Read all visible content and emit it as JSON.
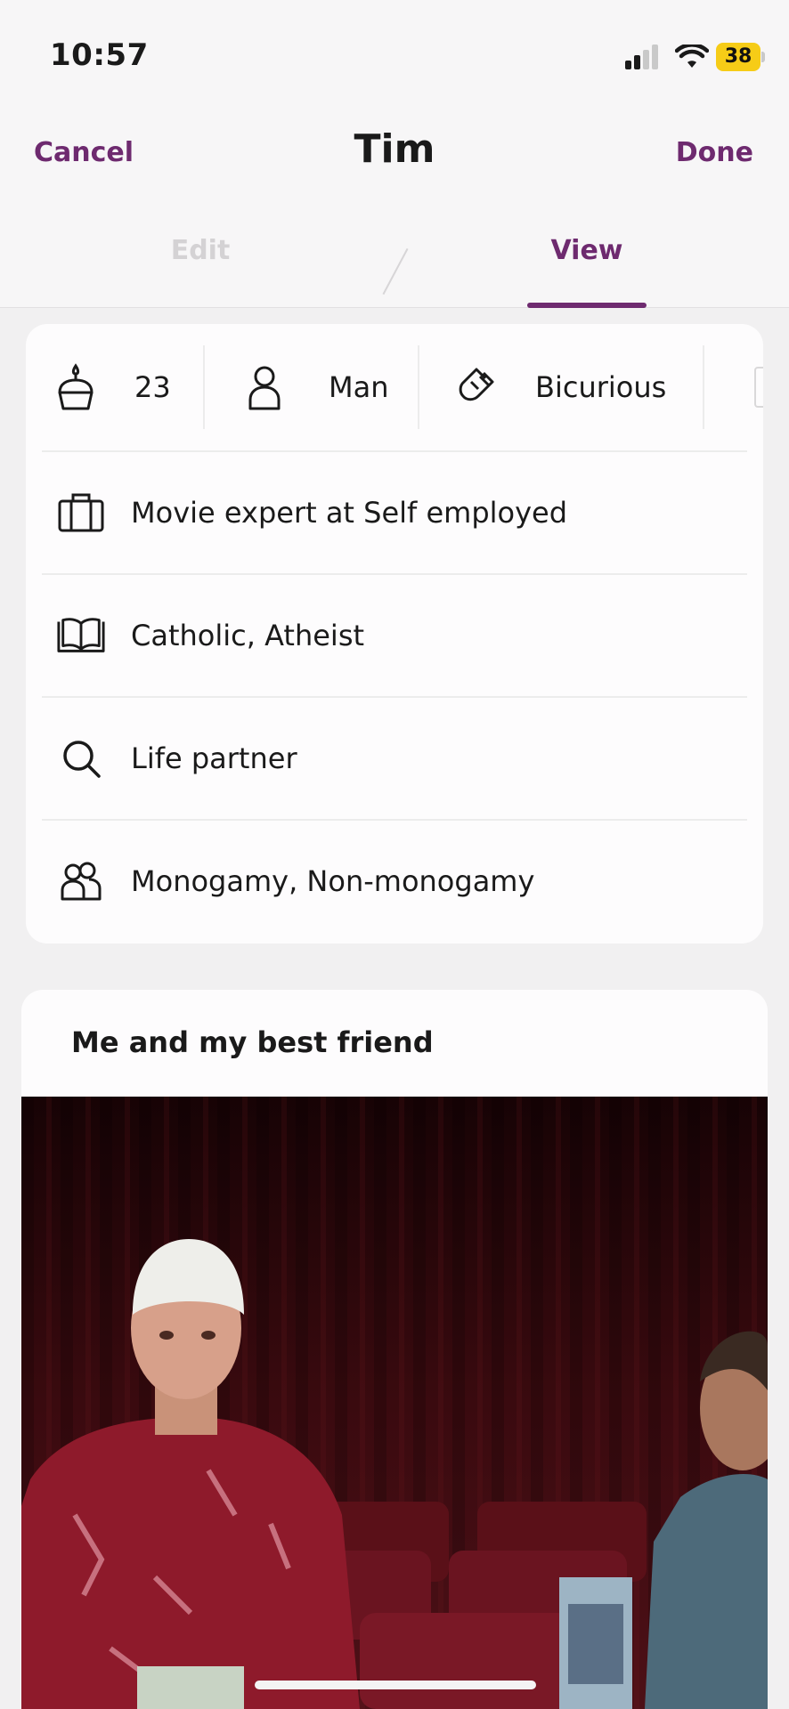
{
  "status_bar": {
    "time": "10:57",
    "battery_level": "38",
    "battery_color": "#f6cc17",
    "icons": [
      "cellular-signal-icon",
      "wifi-icon",
      "battery-icon"
    ]
  },
  "header": {
    "title": "Tim",
    "cancel_label": "Cancel",
    "done_label": "Done",
    "accent_color": "#6e2a6f"
  },
  "tabs": [
    {
      "label": "Edit",
      "active": false
    },
    {
      "label": "View",
      "active": true
    }
  ],
  "profile": {
    "chips": [
      {
        "icon": "birthday-cake-icon",
        "label": "23"
      },
      {
        "icon": "person-icon",
        "label": "Man"
      },
      {
        "icon": "magnet-icon",
        "label": "Bicurious"
      }
    ],
    "rows": [
      {
        "icon": "briefcase-icon",
        "text": "Movie expert at Self employed"
      },
      {
        "icon": "book-icon",
        "text": "Catholic, Atheist"
      },
      {
        "icon": "search-icon",
        "text": "Life partner"
      },
      {
        "icon": "people-icon",
        "text": "Monogamy, Non-monogamy"
      }
    ]
  },
  "prompt": {
    "title": "Me and my best friend"
  }
}
